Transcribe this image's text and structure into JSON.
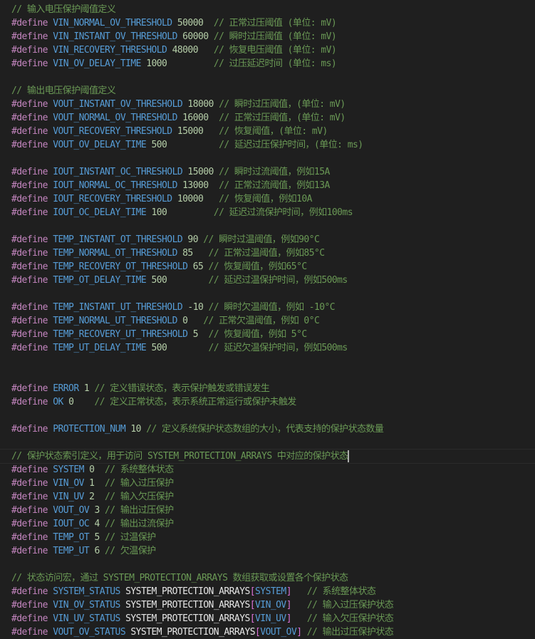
{
  "editor": {
    "lines": [
      {
        "type": "comment",
        "text": "// 输入电压保护阈值定义"
      },
      {
        "type": "define",
        "keyword": "#define",
        "name": "VIN_NORMAL_OV_THRESHOLD",
        "value": "50000",
        "pad": "  ",
        "comment": "// 正常过压阈值 (单位: mV)"
      },
      {
        "type": "define",
        "keyword": "#define",
        "name": "VIN_INSTANT_OV_THRESHOLD",
        "value": "60000",
        "pad": " ",
        "comment": "// 瞬时过压阈值 (单位: mV)"
      },
      {
        "type": "define",
        "keyword": "#define",
        "name": "VIN_RECOVERY_THRESHOLD",
        "value": "48000",
        "pad": "   ",
        "comment": "// 恢复电压阈值 (单位: mV)"
      },
      {
        "type": "define",
        "keyword": "#define",
        "name": "VIN_OV_DELAY_TIME",
        "value": "1000",
        "pad": "         ",
        "comment": "// 过压延迟时间 (单位: ms)"
      },
      {
        "type": "blank"
      },
      {
        "type": "comment",
        "text": "// 输出电压保护阈值定义"
      },
      {
        "type": "define",
        "keyword": "#define",
        "name": "VOUT_INSTANT_OV_THRESHOLD",
        "value": "18000",
        "pad": " ",
        "comment": "// 瞬时过压阈值，(单位: mV)"
      },
      {
        "type": "define",
        "keyword": "#define",
        "name": "VOUT_NORMAL_OV_THRESHOLD",
        "value": "16000",
        "pad": "  ",
        "comment": "// 正常过压阈值，(单位: mV)"
      },
      {
        "type": "define",
        "keyword": "#define",
        "name": "VOUT_RECOVERY_THRESHOLD",
        "value": "15000",
        "pad": "   ",
        "comment": "// 恢复阈值，(单位: mV)"
      },
      {
        "type": "define",
        "keyword": "#define",
        "name": "VOUT_OV_DELAY_TIME",
        "value": "500",
        "pad": "          ",
        "comment": "// 延迟过压保护时间，(单位: ms)"
      },
      {
        "type": "blank"
      },
      {
        "type": "define",
        "keyword": "#define",
        "name": "IOUT_INSTANT_OC_THRESHOLD",
        "value": "15000",
        "pad": " ",
        "comment": "// 瞬时过流阈值，例如15A"
      },
      {
        "type": "define",
        "keyword": "#define",
        "name": "IOUT_NORMAL_OC_THRESHOLD",
        "value": "13000",
        "pad": "  ",
        "comment": "// 正常过流阈值，例如13A"
      },
      {
        "type": "define",
        "keyword": "#define",
        "name": "IOUT_RECOVERY_THRESHOLD",
        "value": "10000",
        "pad": "   ",
        "comment": "// 恢复阈值，例如10A"
      },
      {
        "type": "define",
        "keyword": "#define",
        "name": "IOUT_OC_DELAY_TIME",
        "value": "100",
        "pad": "         ",
        "comment": "// 延迟过流保护时间，例如100ms"
      },
      {
        "type": "blank"
      },
      {
        "type": "define",
        "keyword": "#define",
        "name": "TEMP_INSTANT_OT_THRESHOLD",
        "value": "90",
        "pad": " ",
        "comment": "// 瞬时过温阈值，例如90°C"
      },
      {
        "type": "define",
        "keyword": "#define",
        "name": "TEMP_NORMAL_OT_THRESHOLD",
        "value": "85",
        "pad": "   ",
        "comment": "// 正常过温阈值，例如85°C"
      },
      {
        "type": "define",
        "keyword": "#define",
        "name": "TEMP_RECOVERY_OT_THRESHOLD",
        "value": "65",
        "pad": " ",
        "comment": "// 恢复阈值，例如65°C"
      },
      {
        "type": "define",
        "keyword": "#define",
        "name": "TEMP_OT_DELAY_TIME",
        "value": "500",
        "pad": "        ",
        "comment": "// 延迟过温保护时间，例如500ms"
      },
      {
        "type": "blank"
      },
      {
        "type": "define",
        "keyword": "#define",
        "name": "TEMP_INSTANT_UT_THRESHOLD",
        "value": "-10",
        "pad": " ",
        "comment": "// 瞬时欠温阈值，例如 -10°C"
      },
      {
        "type": "define",
        "keyword": "#define",
        "name": "TEMP_NORMAL_UT_THRESHOLD",
        "value": "0",
        "pad": "   ",
        "comment": "// 正常欠温阈值，例如 0°C"
      },
      {
        "type": "define",
        "keyword": "#define",
        "name": "TEMP_RECOVERY_UT_THRESHOLD",
        "value": "5",
        "pad": "  ",
        "comment": "// 恢复阈值，例如 5°C"
      },
      {
        "type": "define",
        "keyword": "#define",
        "name": "TEMP_UT_DELAY_TIME",
        "value": "500",
        "pad": "        ",
        "comment": "// 延迟欠温保护时间，例如500ms"
      },
      {
        "type": "blank"
      },
      {
        "type": "blank"
      },
      {
        "type": "define",
        "keyword": "#define",
        "name": "ERROR",
        "value": "1",
        "pad": " ",
        "comment": "// 定义错误状态，表示保护触发或错误发生"
      },
      {
        "type": "define",
        "keyword": "#define",
        "name": "OK",
        "value": "0",
        "pad": "    ",
        "comment": "// 定义正常状态，表示系统正常运行或保护未触发"
      },
      {
        "type": "blank"
      },
      {
        "type": "define",
        "keyword": "#define",
        "name": "PROTECTION_NUM",
        "value": "10",
        "pad": " ",
        "comment": "// 定义系统保护状态数组的大小，代表支持的保护状态数量"
      },
      {
        "type": "blank"
      },
      {
        "type": "comment",
        "text": "// 保护状态索引定义，用于访问 SYSTEM_PROTECTION_ARRAYS 中对应的保护状态",
        "current": true
      },
      {
        "type": "define",
        "keyword": "#define",
        "name": "SYSTEM",
        "value": "0",
        "pad": "  ",
        "comment": "// 系统整体状态"
      },
      {
        "type": "define",
        "keyword": "#define",
        "name": "VIN_OV",
        "value": "1",
        "pad": "  ",
        "comment": "// 输入过压保护"
      },
      {
        "type": "define",
        "keyword": "#define",
        "name": "VIN_UV",
        "value": "2",
        "pad": "  ",
        "comment": "// 输入欠压保护"
      },
      {
        "type": "define",
        "keyword": "#define",
        "name": "VOUT_OV",
        "value": "3",
        "pad": " ",
        "comment": "// 输出过压保护"
      },
      {
        "type": "define",
        "keyword": "#define",
        "name": "IOUT_OC",
        "value": "4",
        "pad": " ",
        "comment": "// 输出过流保护"
      },
      {
        "type": "define",
        "keyword": "#define",
        "name": "TEMP_OT",
        "value": "5",
        "pad": " ",
        "comment": "// 过温保护"
      },
      {
        "type": "define",
        "keyword": "#define",
        "name": "TEMP_UT",
        "value": "6",
        "pad": " ",
        "comment": "// 欠温保护"
      },
      {
        "type": "blank"
      },
      {
        "type": "comment",
        "text": "// 状态访问宏，通过 SYSTEM_PROTECTION_ARRAYS 数组获取或设置各个保护状态"
      },
      {
        "type": "access",
        "keyword": "#define",
        "name": "SYSTEM_STATUS",
        "array": "SYSTEM_PROTECTION_ARRAYS",
        "index": "SYSTEM",
        "pad": "   ",
        "comment": "// 系统整体状态"
      },
      {
        "type": "access",
        "keyword": "#define",
        "name": "VIN_OV_STATUS",
        "array": "SYSTEM_PROTECTION_ARRAYS",
        "index": "VIN_OV",
        "pad": "   ",
        "comment": "// 输入过压保护状态"
      },
      {
        "type": "access",
        "keyword": "#define",
        "name": "VIN_UV_STATUS",
        "array": "SYSTEM_PROTECTION_ARRAYS",
        "index": "VIN_UV",
        "pad": "   ",
        "comment": "// 输入欠压保护状态"
      },
      {
        "type": "access",
        "keyword": "#define",
        "name": "VOUT_OV_STATUS",
        "array": "SYSTEM_PROTECTION_ARRAYS",
        "index": "VOUT_OV",
        "pad": " ",
        "comment": "// 输出过压保护状态"
      }
    ]
  },
  "colors": {
    "background": "#1f1f1f",
    "keyword": "#c586c0",
    "identifier": "#569cd6",
    "number": "#b5cea8",
    "comment": "#6a9955",
    "bracket": "#da70d6"
  }
}
